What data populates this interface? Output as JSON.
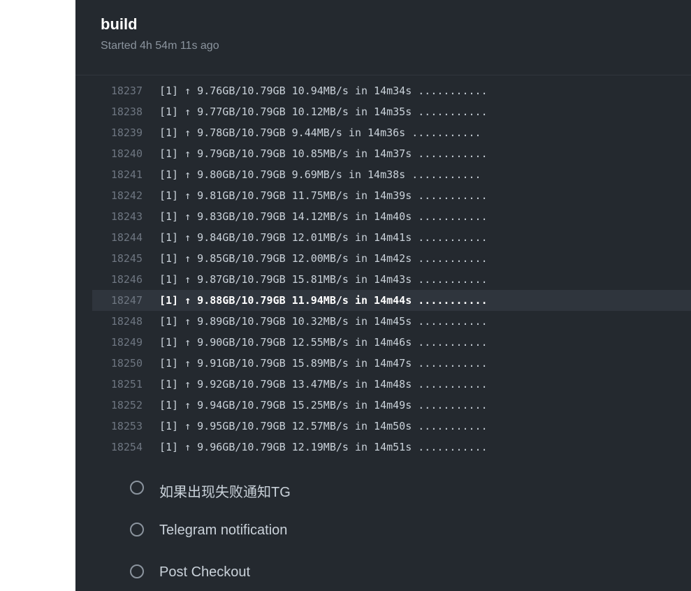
{
  "job": {
    "title": "build",
    "subtitle": "Started 4h 54m 11s ago"
  },
  "log": {
    "lines": [
      {
        "no": "18237",
        "text": "[1] ↑ 9.76GB/10.79GB 10.94MB/s in 14m34s ..........."
      },
      {
        "no": "18238",
        "text": "[1] ↑ 9.77GB/10.79GB 10.12MB/s in 14m35s ..........."
      },
      {
        "no": "18239",
        "text": "[1] ↑ 9.78GB/10.79GB 9.44MB/s in 14m36s ..........."
      },
      {
        "no": "18240",
        "text": "[1] ↑ 9.79GB/10.79GB 10.85MB/s in 14m37s ..........."
      },
      {
        "no": "18241",
        "text": "[1] ↑ 9.80GB/10.79GB 9.69MB/s in 14m38s ..........."
      },
      {
        "no": "18242",
        "text": "[1] ↑ 9.81GB/10.79GB 11.75MB/s in 14m39s ..........."
      },
      {
        "no": "18243",
        "text": "[1] ↑ 9.83GB/10.79GB 14.12MB/s in 14m40s ..........."
      },
      {
        "no": "18244",
        "text": "[1] ↑ 9.84GB/10.79GB 12.01MB/s in 14m41s ..........."
      },
      {
        "no": "18245",
        "text": "[1] ↑ 9.85GB/10.79GB 12.00MB/s in 14m42s ..........."
      },
      {
        "no": "18246",
        "text": "[1] ↑ 9.87GB/10.79GB 15.81MB/s in 14m43s ..........."
      },
      {
        "no": "18247",
        "text": "[1] ↑ 9.88GB/10.79GB 11.94MB/s in 14m44s ..........."
      },
      {
        "no": "18248",
        "text": "[1] ↑ 9.89GB/10.79GB 10.32MB/s in 14m45s ..........."
      },
      {
        "no": "18249",
        "text": "[1] ↑ 9.90GB/10.79GB 12.55MB/s in 14m46s ..........."
      },
      {
        "no": "18250",
        "text": "[1] ↑ 9.91GB/10.79GB 15.89MB/s in 14m47s ..........."
      },
      {
        "no": "18251",
        "text": "[1] ↑ 9.92GB/10.79GB 13.47MB/s in 14m48s ..........."
      },
      {
        "no": "18252",
        "text": "[1] ↑ 9.94GB/10.79GB 15.25MB/s in 14m49s ..........."
      },
      {
        "no": "18253",
        "text": "[1] ↑ 9.95GB/10.79GB 12.57MB/s in 14m50s ..........."
      },
      {
        "no": "18254",
        "text": "[1] ↑ 9.96GB/10.79GB 12.19MB/s in 14m51s ..........."
      }
    ]
  },
  "steps": [
    {
      "label": "如果出现失败通知TG",
      "icon": "pending-circle-icon"
    },
    {
      "label": "Telegram notification",
      "icon": "pending-circle-icon"
    },
    {
      "label": "Post Checkout",
      "icon": "pending-circle-icon"
    }
  ],
  "colors": {
    "panel_bg": "#24292f",
    "highlight_bg": "#2f353d",
    "line_number": "#6e7681",
    "text": "#c9d1d9"
  }
}
